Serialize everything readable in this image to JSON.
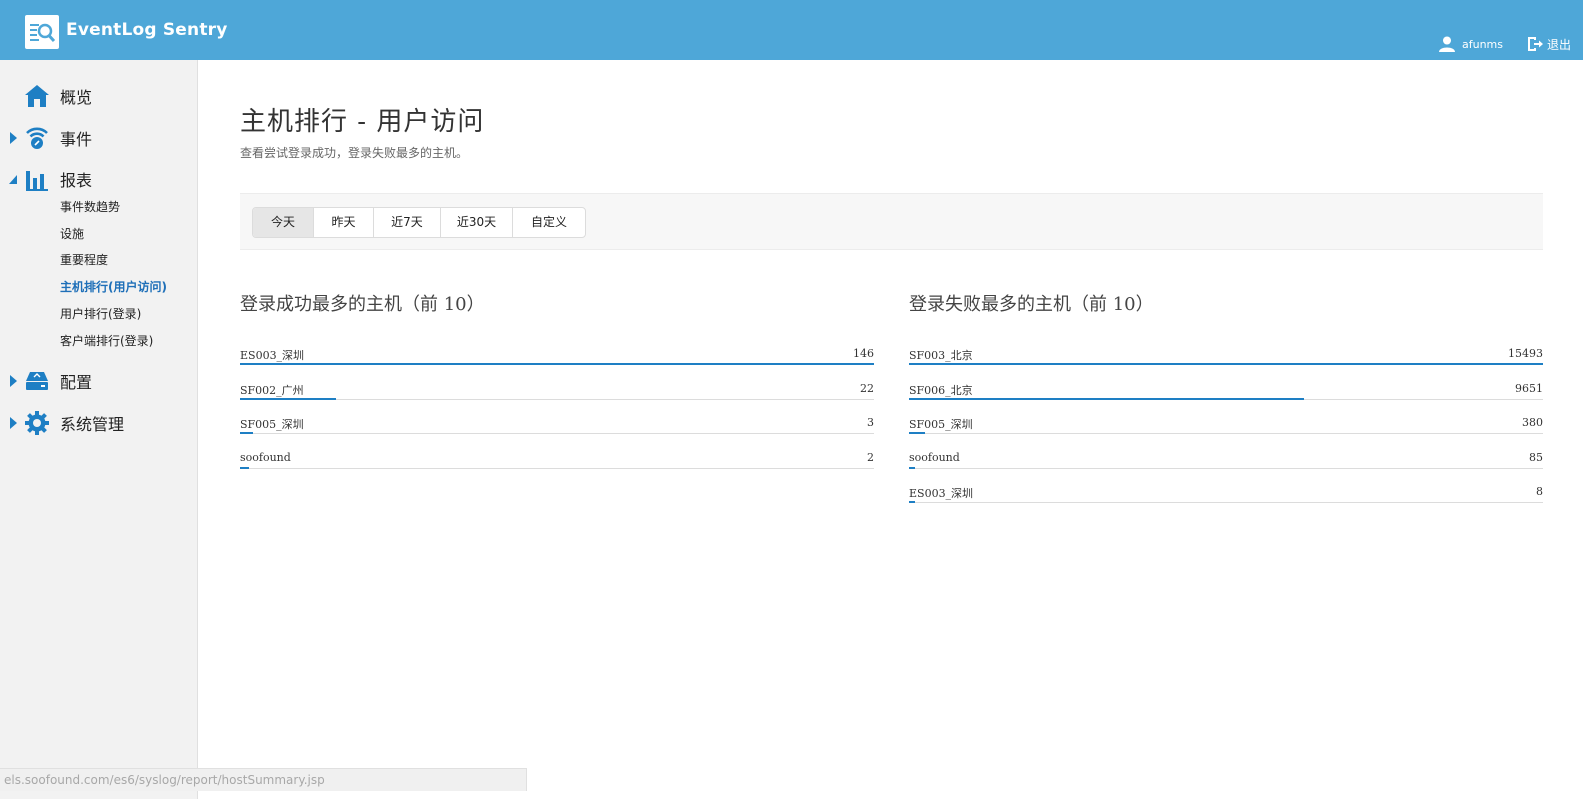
{
  "header": {
    "app_title": "EventLog Sentry",
    "logo_icon": "log-search-icon",
    "username": "afunms",
    "logout_label": "退出"
  },
  "sidebar": {
    "items": [
      {
        "label": "概览",
        "icon": "home-icon"
      },
      {
        "label": "事件",
        "icon": "wifi-event-icon"
      },
      {
        "label": "报表",
        "icon": "bar-chart-icon",
        "subitems": [
          "事件数趋势",
          "设施",
          "重要程度",
          "主机排行(用户访问)",
          "用户排行(登录)",
          "客户端排行(登录)"
        ],
        "active_subitem": "主机排行(用户访问)"
      },
      {
        "label": "配置",
        "icon": "device-icon"
      },
      {
        "label": "系统管理",
        "icon": "gear-icon"
      }
    ]
  },
  "main": {
    "title": "主机排行 - 用户访问",
    "subtitle": "查看尝试登录成功，登录失败最多的主机。",
    "time_filters": [
      "今天",
      "昨天",
      "近7天",
      "近30天",
      "自定义"
    ],
    "active_filter": "今天",
    "success_panel": {
      "title": "登录成功最多的主机（前 10）",
      "rows": [
        {
          "name": "ES003_深圳",
          "value": "146",
          "fraction": 1.0
        },
        {
          "name": "SF002_广州",
          "value": "22",
          "fraction": 0.151
        },
        {
          "name": "SF005_深圳",
          "value": "3",
          "fraction": 0.021
        },
        {
          "name": "soofound",
          "value": "2",
          "fraction": 0.014
        }
      ]
    },
    "failure_panel": {
      "title": "登录失败最多的主机（前 10）",
      "rows": [
        {
          "name": "SF003_北京",
          "value": "15493",
          "fraction": 1.0
        },
        {
          "name": "SF006_北京",
          "value": "9651",
          "fraction": 0.623
        },
        {
          "name": "SF005_深圳",
          "value": "380",
          "fraction": 0.0245
        },
        {
          "name": "soofound",
          "value": "85",
          "fraction": 0.0055
        },
        {
          "name": "ES003_深圳",
          "value": "8",
          "fraction": 0.0005
        }
      ]
    }
  },
  "statusbar": {
    "url": "els.soofound.com/es6/syslog/report/hostSummary.jsp"
  },
  "colors": {
    "header_bg": "#4ea7d8",
    "accent": "#1e7fc4",
    "active_sub": "#1e6fb8",
    "sidebar_bg": "#f2f2f2"
  }
}
